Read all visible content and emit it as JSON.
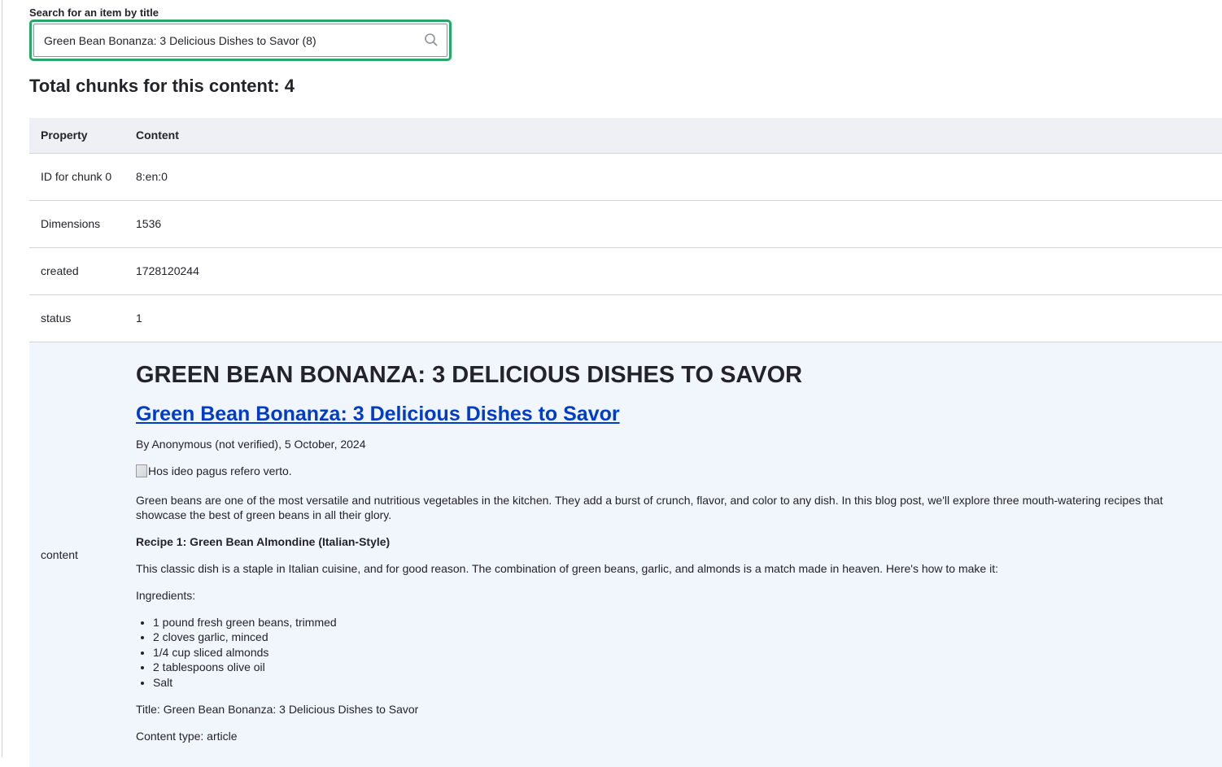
{
  "search": {
    "label": "Search for an item by title",
    "value": "Green Bean Bonanza: 3 Delicious Dishes to Savor (8)",
    "placeholder": ""
  },
  "summary": {
    "total_text": "Total chunks for this content: 4"
  },
  "table": {
    "headers": {
      "property": "Property",
      "content": "Content"
    },
    "rows": [
      {
        "property": "ID for chunk 0",
        "content": "8:en:0"
      },
      {
        "property": "Dimensions",
        "content": "1536"
      },
      {
        "property": "created",
        "content": "1728120244"
      },
      {
        "property": "status",
        "content": "1"
      }
    ],
    "content_row_label": "content"
  },
  "article": {
    "heading_upper": "GREEN BEAN BONANZA: 3 DELICIOUS DISHES TO SAVOR",
    "title_link": "Green Bean Bonanza: 3 Delicious Dishes to Savor",
    "byline": "By Anonymous (not verified), 5 October, 2024",
    "image_alt": "Hos ideo pagus refero verto.",
    "intro": "Green beans are one of the most versatile and nutritious vegetables in the kitchen. They add a burst of crunch, flavor, and color to any dish. In this blog post, we'll explore three mouth-watering recipes that showcase the best of green beans in all their glory.",
    "recipe_title": "Recipe 1: Green Bean Almondine (Italian-Style)",
    "recipe_desc": "This classic dish is a staple in Italian cuisine, and for good reason. The combination of green beans, garlic, and almonds is a match made in heaven. Here's how to make it:",
    "ingredients_label": "Ingredients:",
    "ingredients": [
      "1 pound fresh green beans, trimmed",
      "2 cloves garlic, minced",
      "1/4 cup sliced almonds",
      "2 tablespoons olive oil",
      "Salt"
    ],
    "meta_title": "Title: Green Bean Bonanza: 3 Delicious Dishes to Savor",
    "meta_type": "Content type: article"
  },
  "colors": {
    "focus_border": "#26a769",
    "link": "#003cc5",
    "header_bg": "#eff0f5",
    "content_bg": "#f1f6fd"
  },
  "icons": {
    "search": "search-icon",
    "image": "broken-image-icon"
  }
}
